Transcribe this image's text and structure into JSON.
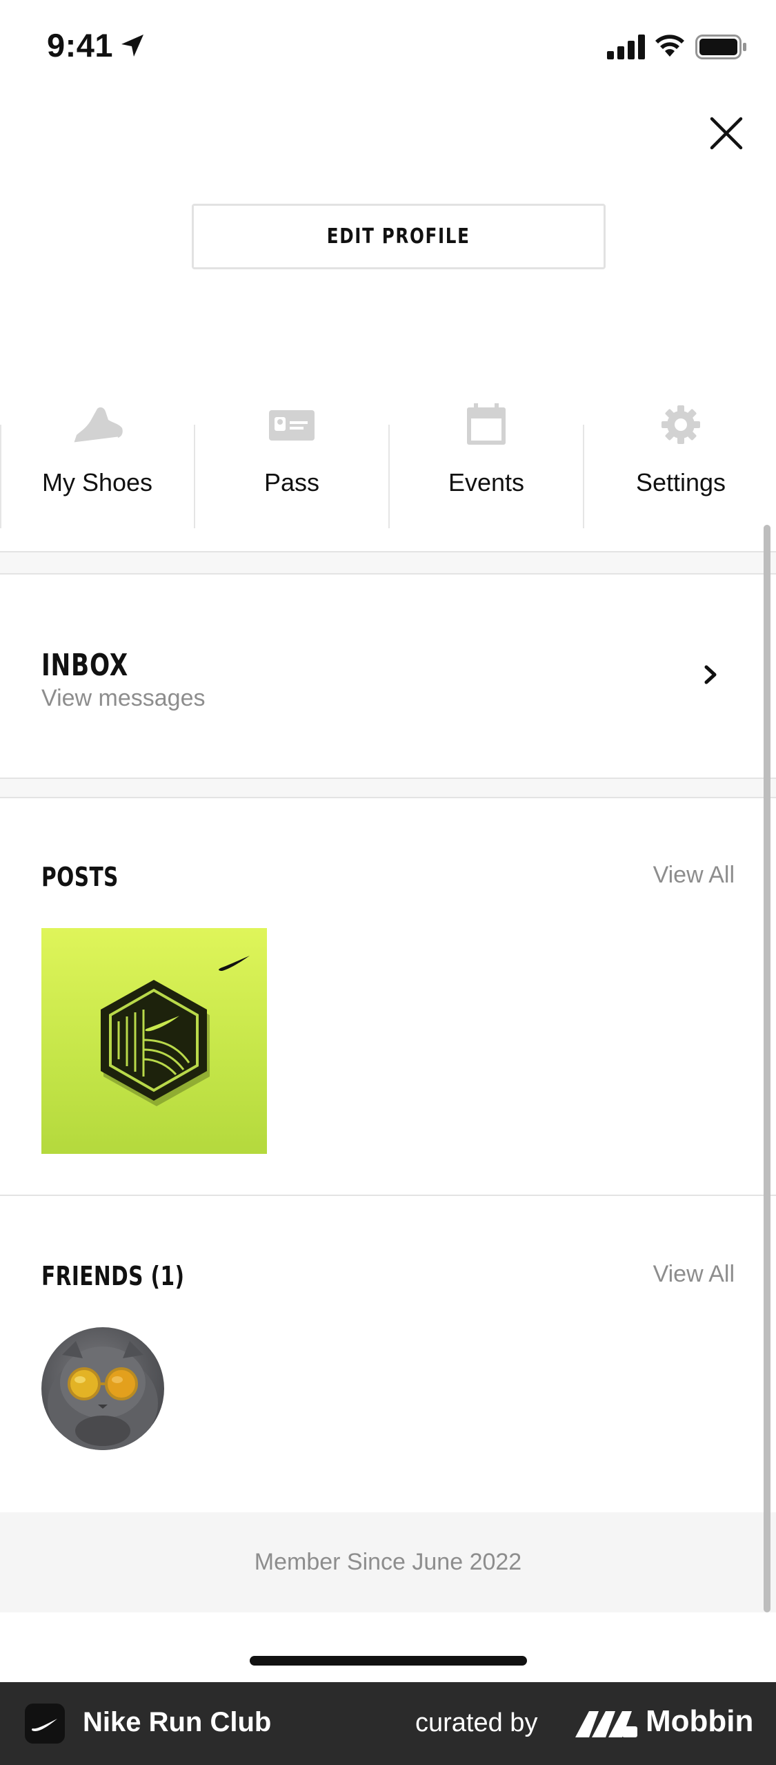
{
  "status_bar": {
    "time": "9:41",
    "icons": [
      "location-arrow-icon",
      "signal-icon",
      "wifi-icon",
      "battery-icon"
    ]
  },
  "header": {
    "close_icon": "close-icon",
    "edit_profile_label": "EDIT PROFILE"
  },
  "quick_links": [
    {
      "label": "My Shoes",
      "icon": "shoe-icon"
    },
    {
      "label": "Pass",
      "icon": "id-card-icon"
    },
    {
      "label": "Events",
      "icon": "calendar-icon"
    },
    {
      "label": "Settings",
      "icon": "gear-icon"
    }
  ],
  "inbox": {
    "title": "INBOX",
    "subtitle": "View messages",
    "icon": "chevron-right-icon"
  },
  "posts": {
    "title": "POSTS",
    "view_all": "View All",
    "items": [
      {
        "type": "image",
        "icon": "nike-badge-icon",
        "background": "#d4ef4f"
      }
    ]
  },
  "friends": {
    "title": "FRIENDS (1)",
    "view_all": "View All",
    "items": [
      {
        "type": "avatar",
        "icon": "cat-sunglasses-avatar"
      }
    ]
  },
  "footer": {
    "member_since": "Member Since June 2022"
  },
  "bottom_bar": {
    "app_name": "Nike Run Club",
    "curated_by": "curated by",
    "brand": "Mobbin"
  },
  "colors": {
    "text_primary": "#111111",
    "text_secondary": "#8d8d8d",
    "divider": "#e3e3e3",
    "post_green": "#d4ef4f",
    "bottom_bar_bg": "#2b2b2b"
  }
}
